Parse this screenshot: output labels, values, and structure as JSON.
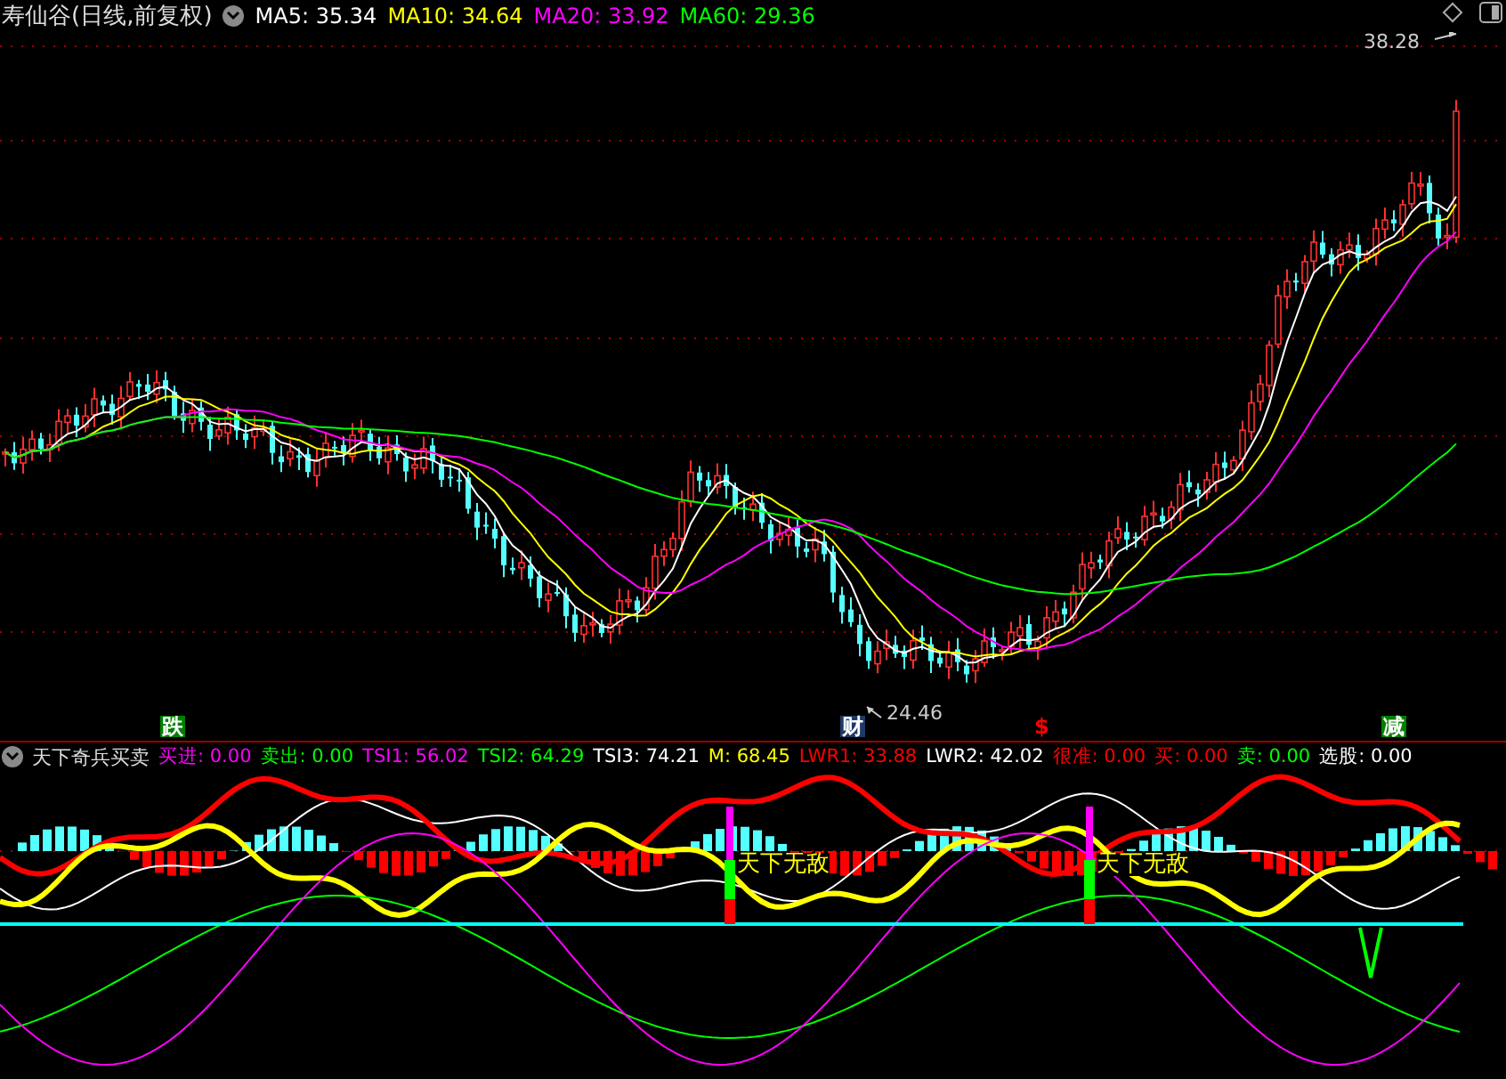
{
  "title": "寿仙谷(日线,前复权)",
  "ma_legend": [
    {
      "label": "MA5: 35.34",
      "color": "#ffffff"
    },
    {
      "label": "MA10: 34.64",
      "color": "#ffff00"
    },
    {
      "label": "MA20: 33.92",
      "color": "#ff00ff"
    },
    {
      "label": "MA60: 29.36",
      "color": "#00ff00"
    }
  ],
  "price_labels": {
    "high": "38.28",
    "low": "24.46"
  },
  "event_markers": [
    {
      "text": "跌",
      "kind": "badge",
      "color": "#008000"
    },
    {
      "text": "财",
      "kind": "badge",
      "color": "#1e3a66"
    },
    {
      "text": "$",
      "kind": "plain",
      "color": "#ff0000"
    },
    {
      "text": "减",
      "kind": "badge",
      "color": "#008000"
    }
  ],
  "indicator": {
    "name": "天下奇兵买卖",
    "values": [
      {
        "label": "买进: 0.00",
        "color": "#ff00ff"
      },
      {
        "label": "卖出: 0.00",
        "color": "#00ff00"
      },
      {
        "label": "TSI1: 56.02",
        "color": "#ff00ff"
      },
      {
        "label": "TSI2: 64.29",
        "color": "#00ff00"
      },
      {
        "label": "TSI3: 74.21",
        "color": "#ffffff"
      },
      {
        "label": "M: 68.45",
        "color": "#ffff00"
      },
      {
        "label": "LWR1: 33.88",
        "color": "#ff0000"
      },
      {
        "label": "LWR2: 42.02",
        "color": "#ffffff"
      },
      {
        "label": "很准: 0.00",
        "color": "#ff0000"
      },
      {
        "label": "买: 0.00",
        "color": "#ff0000"
      },
      {
        "label": "卖: 0.00",
        "color": "#00ff00"
      },
      {
        "label": "选股: 0.00",
        "color": "#ffffff"
      }
    ],
    "signals": [
      "天下无敌",
      "天下无敌"
    ]
  }
}
